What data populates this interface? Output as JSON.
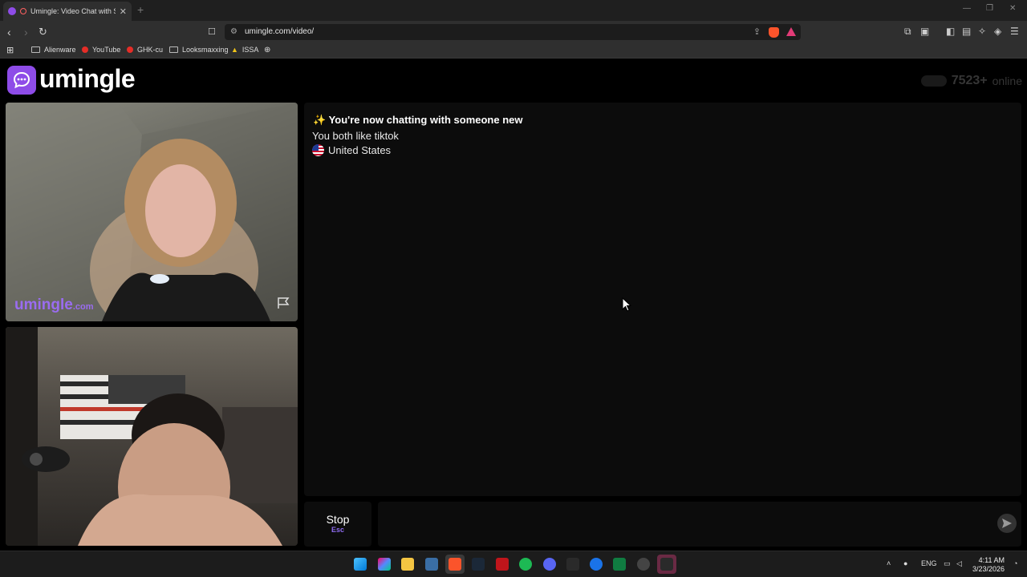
{
  "browser": {
    "tab_title": "Umingle: Video Chat with Stra",
    "tab_close": "✕",
    "new_tab": "+",
    "url": "umingle.com/video/",
    "bookmarks": [
      "Alienware",
      "YouTube",
      "GHK-cu",
      "Looksmaxxing",
      "ISSA"
    ]
  },
  "header": {
    "logo_text": "umingle",
    "online_count": "7523+",
    "online_label": "online"
  },
  "video": {
    "watermark_main": "umingle",
    "watermark_suffix": ".com"
  },
  "chat": {
    "title": "✨ You're now chatting with someone new",
    "interest": "You both like tiktok",
    "country": "United States"
  },
  "controls": {
    "stop_label": "Stop",
    "stop_key": "Esc"
  },
  "taskbar": {
    "language": "ENG",
    "time": "4:11 AM",
    "date": "3/23/2026"
  },
  "colors": {
    "brand": "#8e4ce8",
    "background": "#000000",
    "panel": "#0c0c0c"
  }
}
